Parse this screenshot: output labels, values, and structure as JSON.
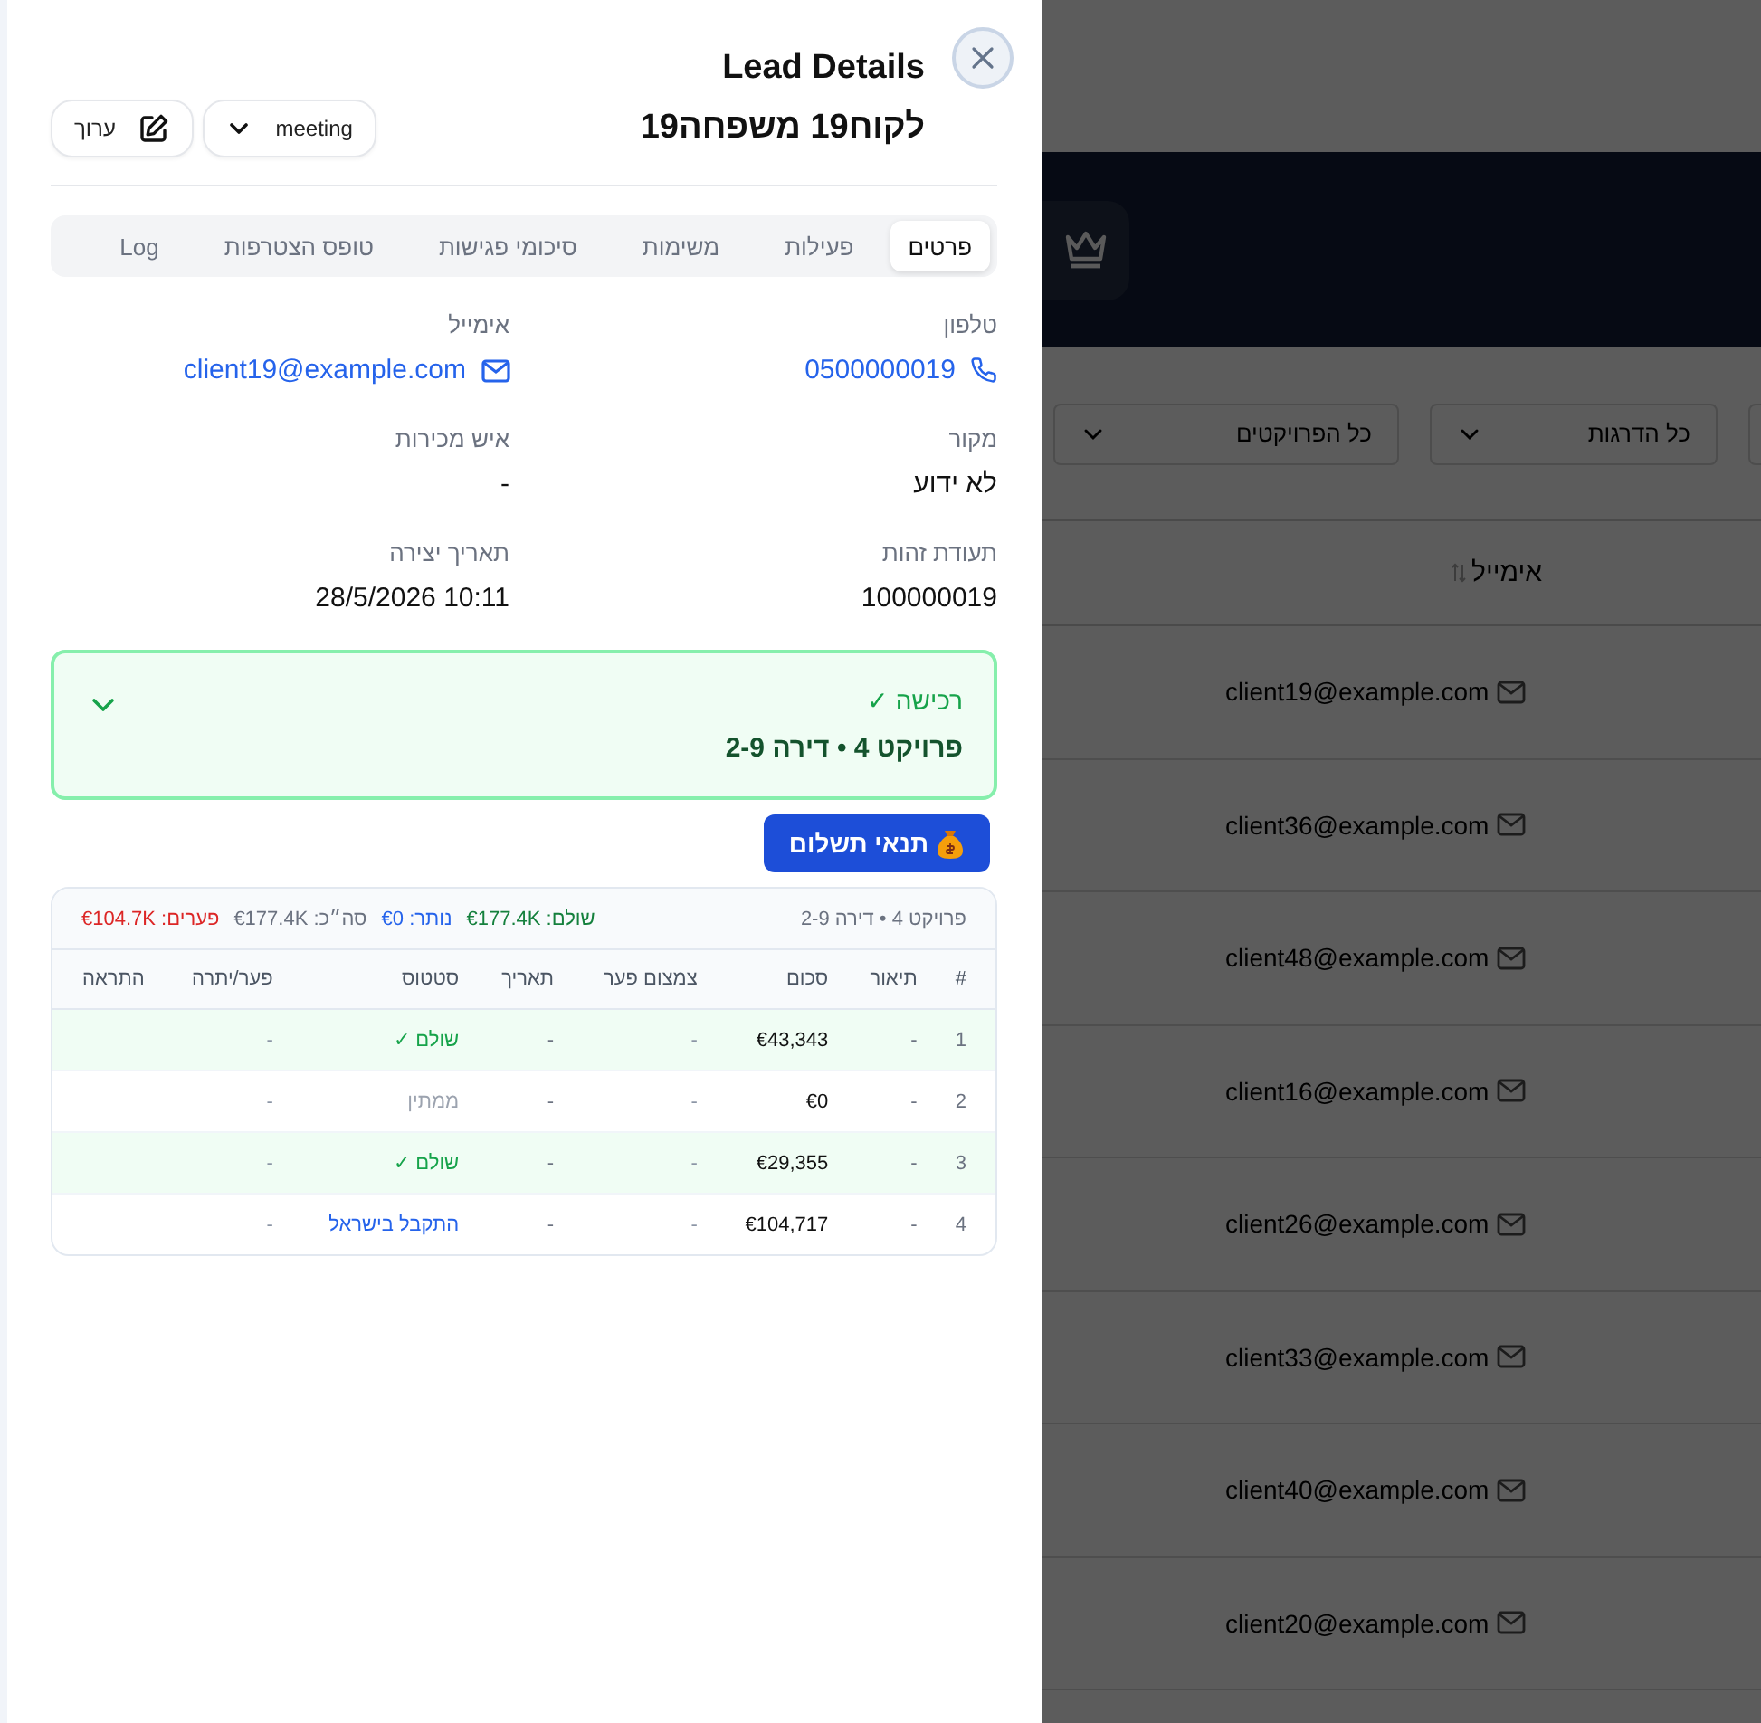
{
  "drawer": {
    "title": "Lead Details",
    "lead_name": "לקוח19 משפחה19",
    "status_select": {
      "value": "meeting"
    },
    "edit_button": "ערוך",
    "tabs": [
      {
        "label": "פרטים",
        "selected": true
      },
      {
        "label": "פעילות",
        "selected": false
      },
      {
        "label": "משימות",
        "selected": false
      },
      {
        "label": "סיכומי פגישות",
        "selected": false
      },
      {
        "label": "טופס הצטרפות",
        "selected": false
      },
      {
        "label": "Log",
        "selected": false
      }
    ],
    "fields": [
      {
        "label": "טלפון",
        "value": "0500000019",
        "kind": "phone"
      },
      {
        "label": "אימייל",
        "value": "client19@example.com",
        "kind": "email"
      },
      {
        "label": "מקור",
        "value": "לא ידוע",
        "kind": "text"
      },
      {
        "label": "איש מכירות",
        "value": "-",
        "kind": "text"
      },
      {
        "label": "תעודת זהות",
        "value": "100000019",
        "kind": "text"
      },
      {
        "label": "תאריך יצירה",
        "value": "10:11 28/5/2026",
        "kind": "text"
      }
    ],
    "purchase": {
      "title": "רכישה ✓",
      "unit": "פרויקט 4 • דירה 2-9",
      "expanded": false
    },
    "payment_button": "תנאי תשלום",
    "payments": {
      "project": "פרויקט 4 • דירה 2-9",
      "summary": [
        {
          "label": "שולם: €177.4K",
          "color": "#15803d"
        },
        {
          "label": "נותר: €0",
          "color": "#2563eb"
        },
        {
          "label": "סה״כ: €177.4K",
          "color": "#6b7280"
        },
        {
          "label": "פערים: €104.7K",
          "color": "#dc2626"
        }
      ],
      "columns": [
        "#",
        "תיאור",
        "סכום",
        "צמצום פער",
        "תאריך",
        "סטטוס",
        "פער/יתרה",
        "התראה"
      ],
      "rows": [
        {
          "number": "1",
          "description": "-",
          "amount": "€43,343",
          "gap_reduction": "-",
          "date": "-",
          "status": "שולם ✓",
          "kind": "paid",
          "balance": "-"
        },
        {
          "number": "2",
          "description": "-",
          "amount": "€0",
          "gap_reduction": "-",
          "date": "-",
          "status": "ממתין",
          "kind": "pending",
          "balance": "-"
        },
        {
          "number": "3",
          "description": "-",
          "amount": "€29,355",
          "gap_reduction": "-",
          "date": "-",
          "status": "שולם ✓",
          "kind": "paid",
          "balance": "-"
        },
        {
          "number": "4",
          "description": "-",
          "amount": "€104,717",
          "gap_reduction": "-",
          "date": "-",
          "status": "התקבל בישראל",
          "kind": "received",
          "balance": "-"
        }
      ]
    }
  },
  "background": {
    "filters": [
      "כל הדרגות",
      "כל הפרויקטים"
    ],
    "email_column": "אימייל",
    "emails": [
      "client19@example.com",
      "client36@example.com",
      "client48@example.com",
      "client16@example.com",
      "client26@example.com",
      "client33@example.com",
      "client40@example.com",
      "client20@example.com"
    ]
  }
}
